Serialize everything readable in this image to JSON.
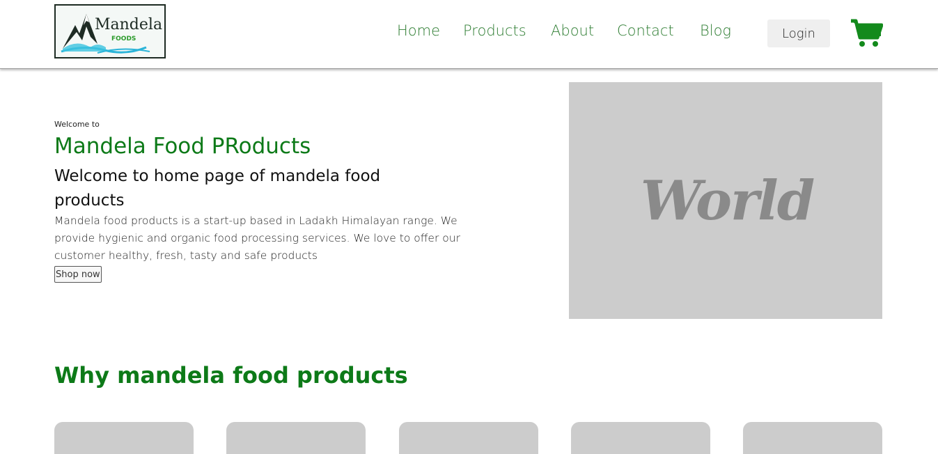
{
  "header": {
    "logo": {
      "brand_text": "andela",
      "brand_initial": "M",
      "sub_text": "FOODS"
    },
    "nav": [
      {
        "label": "Home"
      },
      {
        "label": "Products"
      },
      {
        "label": "About"
      },
      {
        "label": "Contact"
      },
      {
        "label": "Blog"
      }
    ],
    "login_label": "Login",
    "cart_icon": "shopping-cart-icon"
  },
  "hero": {
    "welcome_small": "Welcome to",
    "title": "Mandela Food PRoducts",
    "subtitle": "Welcome to home page of mandela food products",
    "description": "Mandela food products is a start-up based in Ladakh Himalayan range. We provide hygienic and organic food processing services. We love to offer our customer healthy, fresh, tasty and safe products",
    "shop_button": "Shop now",
    "image_text": "World"
  },
  "why": {
    "title": "Why mandela food products",
    "cards": [
      {},
      {},
      {},
      {},
      {}
    ]
  },
  "colors": {
    "brand_green": "#0d7a18",
    "nav_green": "#2e7d32",
    "placeholder_gray": "#cccccc",
    "cart_green": "#138a1c"
  }
}
